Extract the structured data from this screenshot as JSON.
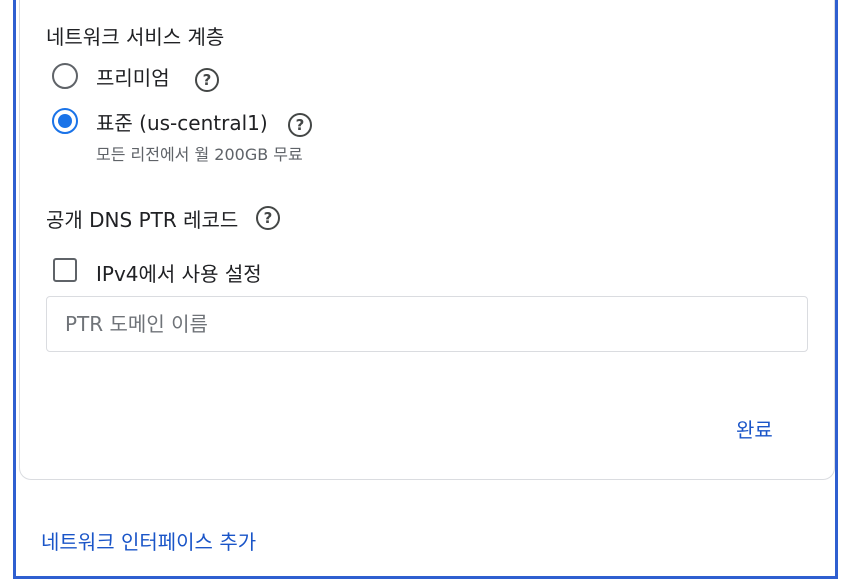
{
  "network_tier": {
    "title": "네트워크 서비스 계층",
    "options": [
      {
        "label": "프리미엄",
        "checked": false
      },
      {
        "label": "표준 (us-central1)",
        "description": "모든 리전에서 월 200GB 무료",
        "checked": true
      }
    ]
  },
  "ptr_record": {
    "title": "공개 DNS PTR 레코드",
    "checkbox_label": "IPv4에서 사용 설정",
    "checkbox_checked": false,
    "input_placeholder": "PTR 도메인 이름",
    "input_value": ""
  },
  "actions": {
    "done_label": "완료",
    "add_interface_label": "네트워크 인터페이스 추가"
  },
  "icons": {
    "help": "help-circle-icon",
    "help_glyph": "?"
  },
  "colors": {
    "accent": "#1a73e8",
    "link": "#1a55c8",
    "frame_border": "#2f5fd0"
  }
}
